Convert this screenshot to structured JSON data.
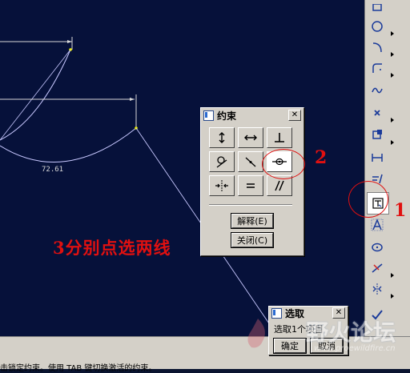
{
  "canvas": {
    "dimension_label": "72.61"
  },
  "constraint_dialog": {
    "title": "约束",
    "close_label": "✕",
    "buttons": [
      {
        "name": "vertical-constraint"
      },
      {
        "name": "horizontal-constraint"
      },
      {
        "name": "perpendicular-constraint"
      },
      {
        "name": "tangent-constraint"
      },
      {
        "name": "point-on-entity-constraint"
      },
      {
        "name": "midpoint-constraint"
      },
      {
        "name": "symmetric-constraint"
      },
      {
        "name": "equal-constraint"
      },
      {
        "name": "parallel-constraint"
      }
    ],
    "explain_label": "解释(E)",
    "close_button_label": "关闭(C)"
  },
  "select_dialog": {
    "title": "选取",
    "close_label": "✕",
    "message": "选取1个项目",
    "ok_label": "确定",
    "cancel_label": "取消"
  },
  "annotations": {
    "step1": "1",
    "step2": "2",
    "step3": "3分别点选两线"
  },
  "status_bar": {
    "text": "击锁定约束。使用 TAB 键切换激活的约束。"
  },
  "watermark": {
    "text": "野火论坛",
    "url": "www.proewildfire.cn"
  },
  "colors": {
    "canvas_bg": "#06113a",
    "geometry": "#c8c8ff",
    "annotation_red": "#e01010",
    "highlight_yellow": "#f0f000"
  }
}
